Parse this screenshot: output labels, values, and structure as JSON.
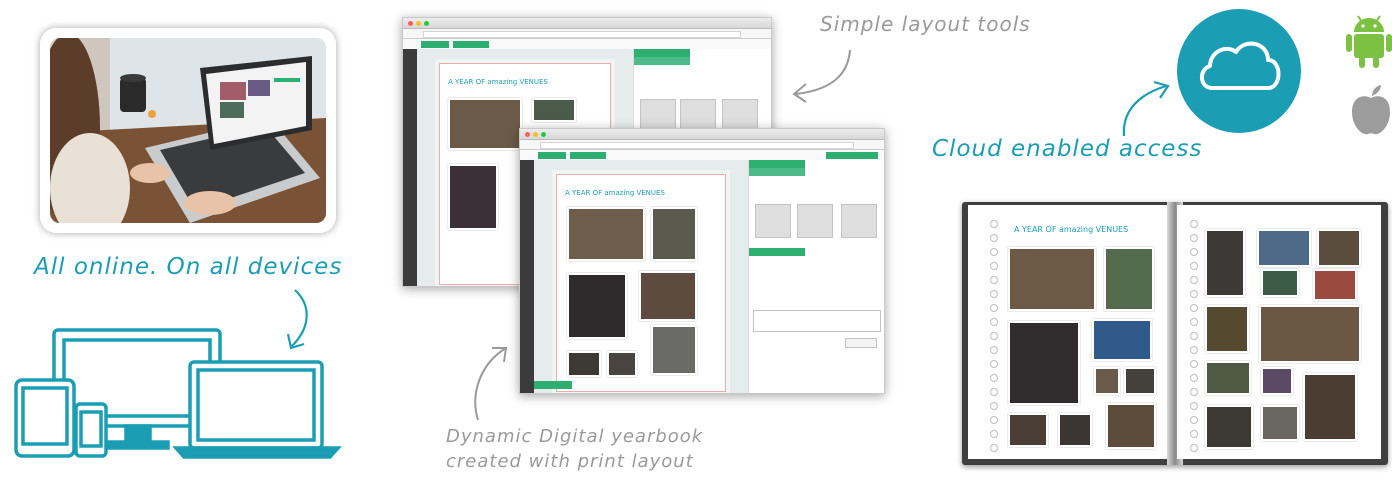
{
  "captions": {
    "all_online": "All online. On all devices",
    "simple_layout": "Simple layout tools",
    "dynamic_line1": "Dynamic Digital yearbook",
    "dynamic_line2": "created with print layout",
    "cloud_access": "Cloud enabled access"
  },
  "editor": {
    "page_title_back": "A YEAR OF amazing VENUES",
    "page_title_front": "A YEAR OF amazing VENUES",
    "book_title": "A YEAR OF amazing VENUES"
  },
  "icons": [
    "photo-laptop",
    "devices-icon",
    "cloud-icon",
    "android-icon",
    "apple-icon",
    "arrow-icon"
  ],
  "colors": {
    "teal": "#1b9db3",
    "green": "#2eaf72",
    "android_green": "#7cc142",
    "apple_grey": "#9c9c9c",
    "caption_grey": "#9a9a9a"
  }
}
